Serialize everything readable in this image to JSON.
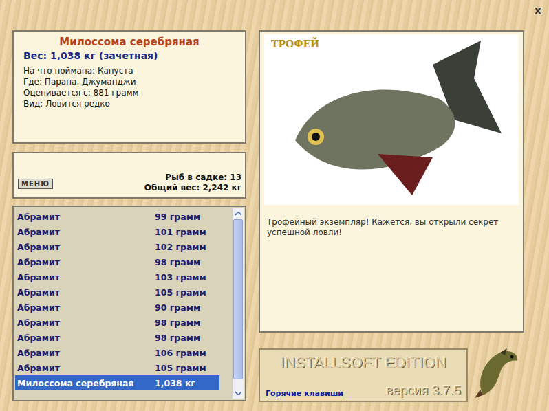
{
  "window": {
    "close": "X"
  },
  "fish_info": {
    "name": "Милоссома серебряная",
    "weight": "Вес: 1,038 кг (зачетная)",
    "details": [
      "На что поймана: Капуста",
      "Где: Парана, Джуманджи",
      "Оценивается с: 881 грамм",
      "Вид: Ловится редко"
    ]
  },
  "keepnet": {
    "menu_button": "МЕНЮ",
    "count": "Рыб в садке: 13",
    "total": "Общий вес: 2,242 кг"
  },
  "catch_list": [
    {
      "name": "Абрамит",
      "weight": "99 грамм",
      "selected": false
    },
    {
      "name": "Абрамит",
      "weight": "101 грамм",
      "selected": false
    },
    {
      "name": "Абрамит",
      "weight": "102 грамм",
      "selected": false
    },
    {
      "name": "Абрамит",
      "weight": "98 грамм",
      "selected": false
    },
    {
      "name": "Абрамит",
      "weight": "103 грамм",
      "selected": false
    },
    {
      "name": "Абрамит",
      "weight": "105 грамм",
      "selected": false
    },
    {
      "name": "Абрамит",
      "weight": "90 грамм",
      "selected": false
    },
    {
      "name": "Абрамит",
      "weight": "98 грамм",
      "selected": false
    },
    {
      "name": "Абрамит",
      "weight": "98 грамм",
      "selected": false
    },
    {
      "name": "Абрамит",
      "weight": "106 грамм",
      "selected": false
    },
    {
      "name": "Абрамит",
      "weight": "105 грамм",
      "selected": false
    },
    {
      "name": "Милоссома серебряная",
      "weight": "1,038 кг",
      "selected": true
    }
  ],
  "scrollbar": {
    "level": 0.95
  },
  "trophy": {
    "badge": "ТРОФЕЙ",
    "message": "Трофейный экземпляр! Кажется, вы открыли секрет успешной ловли!"
  },
  "footer": {
    "brand": "INSTALLSOFT EDITION",
    "version": "версия 3.7.5",
    "hotkeys_link": "Горячие клавиши"
  }
}
